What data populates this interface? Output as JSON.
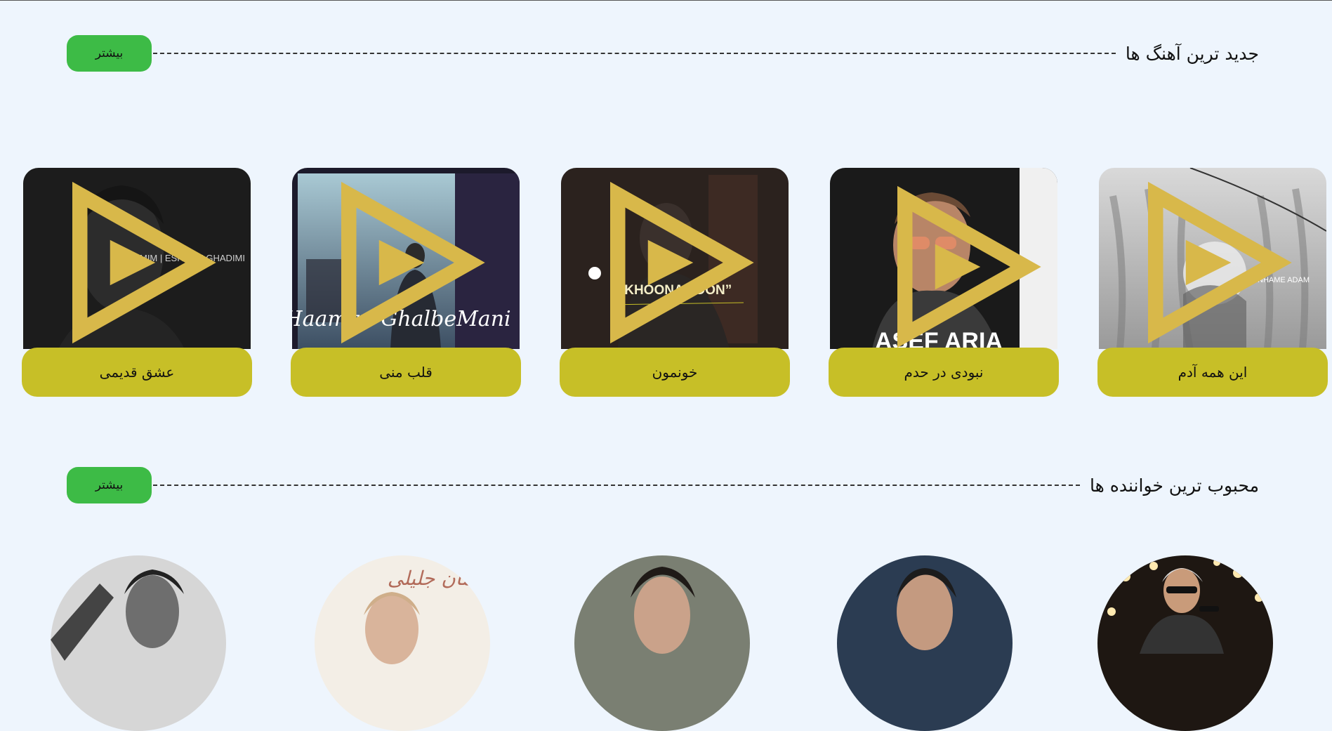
{
  "sections": {
    "newest_songs": {
      "title": "جدید ترین آهنگ ها",
      "more_label": "بیشتر"
    },
    "popular_singers": {
      "title": "محبوب ترین خواننده ها",
      "more_label": "بیشتر"
    }
  },
  "songs": [
    {
      "title": "این همه آدم",
      "art_text": "INHAME ADAM"
    },
    {
      "title": "نبودی در حدم",
      "art_text": "ASEF ARIA"
    },
    {
      "title": "خونمون",
      "art_text": "“KHOONAMOON”"
    },
    {
      "title": "قلب منی",
      "art_text": "Haamim GhalbeMani"
    },
    {
      "title": "عشق قدیمی",
      "art_text": "HAAMIM | ESHGHE GHADIMI"
    }
  ],
  "artist_avatar_texts": {
    "saman": "سامان جلیلی"
  },
  "colors": {
    "background": "#eef5fd",
    "more_button": "#3dbb46",
    "song_label": "#c7bf27",
    "play_badge": "#d8b84a"
  },
  "icons": {
    "play_badge": "play-badge-icon"
  }
}
